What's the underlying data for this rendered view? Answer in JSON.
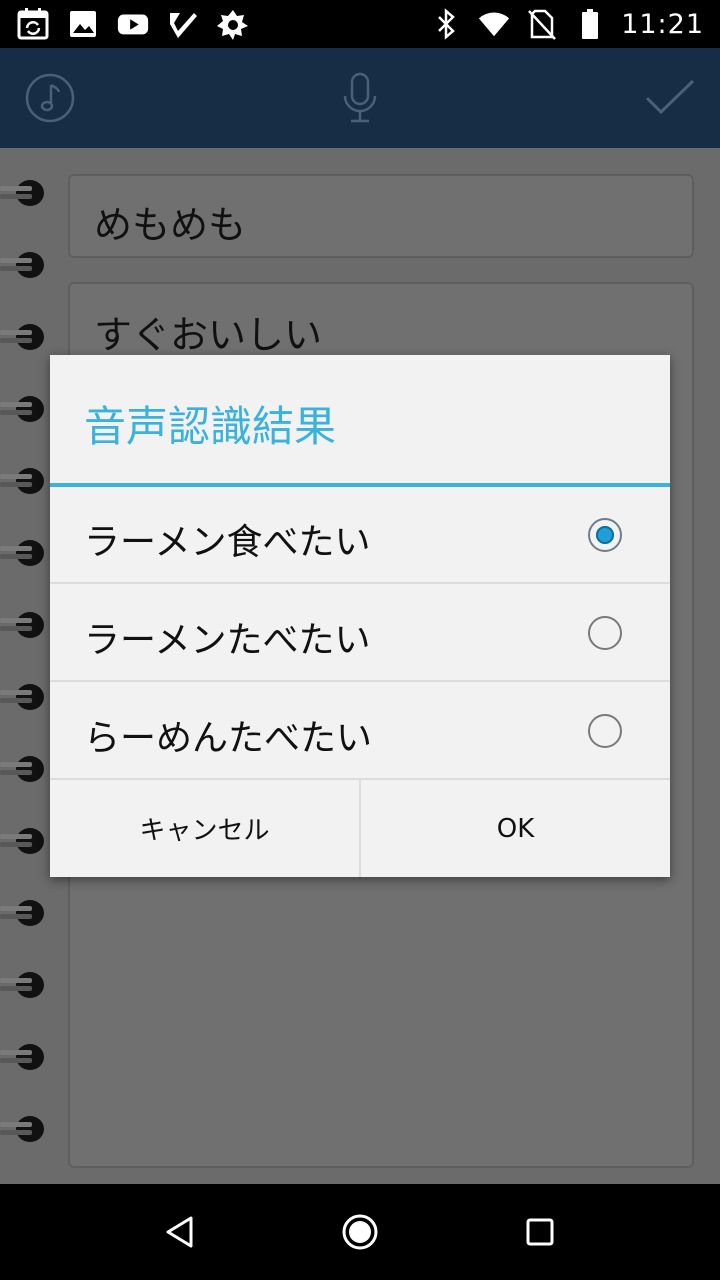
{
  "status_bar": {
    "time": "11:21",
    "left_icons": [
      "calendar-sync-icon",
      "image-icon",
      "youtube-icon",
      "check-app-icon",
      "gear-app-icon"
    ],
    "right_icons": [
      "bluetooth-icon",
      "wifi-icon",
      "no-sim-icon",
      "battery-icon"
    ]
  },
  "app_bar": {
    "icons": [
      "music-note-icon",
      "microphone-icon",
      "checkmark-icon"
    ]
  },
  "memo": {
    "title": "めもめも",
    "body": "すぐおいしい"
  },
  "dialog": {
    "title": "音声認識結果",
    "options": [
      {
        "label": "ラーメン食べたい",
        "selected": true
      },
      {
        "label": "ラーメンたべたい",
        "selected": false
      },
      {
        "label": "らーめんたべたい",
        "selected": false
      }
    ],
    "cancel_label": "キャンセル",
    "ok_label": "OK"
  },
  "colors": {
    "accent": "#3ab2dc",
    "app_bar": "#172c45",
    "radio_selected": "#1f9fd9"
  },
  "nav_bar": {
    "icons": [
      "back-icon",
      "home-icon",
      "recents-icon"
    ]
  }
}
